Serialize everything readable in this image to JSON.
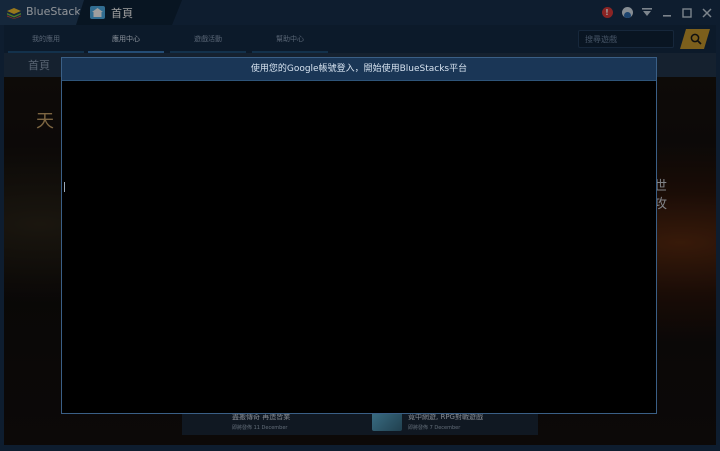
{
  "window": {
    "app_name": "BlueStacks",
    "tab_label": "首頁",
    "alert_badge": "!"
  },
  "nav": {
    "items": [
      {
        "label": "我的應用"
      },
      {
        "label": "應用中心"
      },
      {
        "label": "遊戲活動"
      },
      {
        "label": "幫助中心"
      }
    ],
    "active_index": 1,
    "search_placeholder": "搜尋遊戲"
  },
  "content": {
    "page_title": "首頁",
    "banner_glyphs": {
      "left": "天",
      "right_top": "世",
      "right_bottom": "攻"
    },
    "cards": [
      {
        "title": "盡搬傳奇 再造皆業",
        "date": "即將發佈 11 December"
      },
      {
        "title": "竟中網遊, RPG對戰遊戲",
        "date": "即將發佈 7 December"
      }
    ]
  },
  "modal": {
    "title": "使用您的Google帳號登入，開始使用BlueStacks平台"
  },
  "colors": {
    "titlebar": "#172f4c",
    "accent": "#3b7dbf",
    "search_button": "#c99a2e",
    "modal_header": "#1a3656"
  }
}
